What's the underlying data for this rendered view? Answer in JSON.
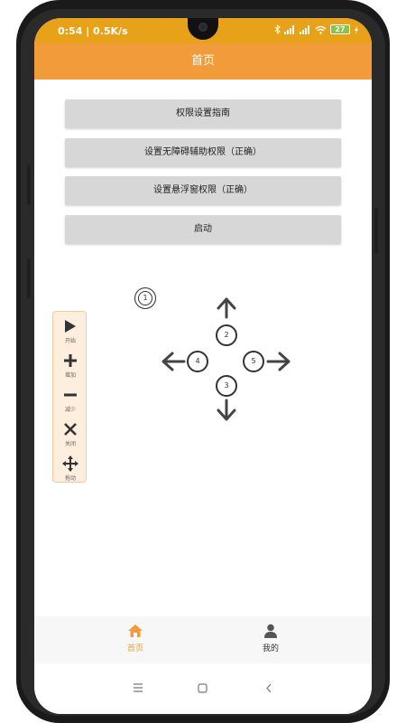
{
  "status_bar": {
    "left_text": "0:54 | 0.5K/s",
    "battery": "27",
    "icons": [
      "bluetooth-icon",
      "signal-icon",
      "signal-icon",
      "wifi-icon",
      "battery-icon",
      "charging-icon"
    ]
  },
  "app_bar": {
    "title": "首页"
  },
  "buttons": [
    {
      "label": "权限设置指南"
    },
    {
      "label": "设置无障碍辅助权限（正确）"
    },
    {
      "label": "设置悬浮窗权限（正确）"
    },
    {
      "label": "启动"
    }
  ],
  "toolbar": {
    "items": [
      {
        "icon": "play-icon",
        "label": "开始"
      },
      {
        "icon": "plus-icon",
        "label": "增加"
      },
      {
        "icon": "minus-icon",
        "label": "减少"
      },
      {
        "icon": "close-icon",
        "label": "关闭"
      },
      {
        "icon": "move-icon",
        "label": "拖动"
      }
    ]
  },
  "pad": {
    "markers": [
      "1",
      "2",
      "3",
      "4",
      "5"
    ]
  },
  "bottom_nav": {
    "items": [
      {
        "icon": "home-icon",
        "label": "首页",
        "active": true
      },
      {
        "icon": "person-icon",
        "label": "我的",
        "active": false
      }
    ]
  },
  "colors": {
    "status_bar": "#e8a21a",
    "app_bar": "#f29b3a",
    "active_nav": "#f29b3a"
  }
}
